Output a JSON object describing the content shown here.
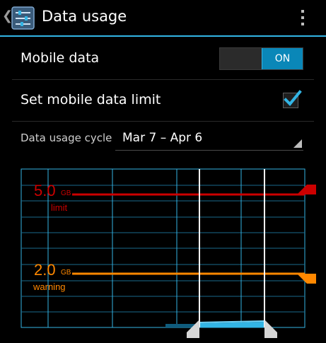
{
  "header": {
    "title": "Data usage",
    "up_icon": "chevron-left-icon",
    "app_icon": "settings-sliders-icon",
    "menu_icon": "overflow-menu-icon"
  },
  "mobile_data": {
    "label": "Mobile data",
    "toggle": "ON"
  },
  "data_limit": {
    "label": "Set mobile data limit",
    "checked": true
  },
  "cycle": {
    "label": "Data usage cycle",
    "value": "Mar 7 – Apr 6"
  },
  "chart": {
    "limit_value": "5.0",
    "limit_unit": "GB",
    "limit_label": "limit",
    "warning_value": "2.0",
    "warning_unit": "GB",
    "warning_label": "warning",
    "colors": {
      "limit": "#cc0000",
      "warning": "#ff8800",
      "grid": "#33b5e5",
      "usage": "#33b5e5"
    }
  }
}
